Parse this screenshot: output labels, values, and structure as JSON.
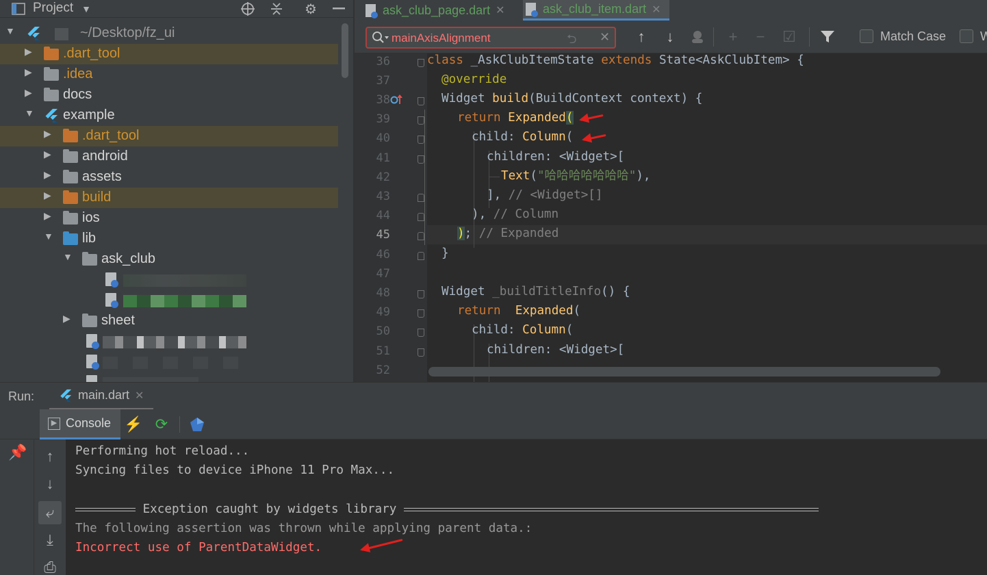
{
  "project_panel": {
    "title": "Project",
    "root_path": "~/Desktop/fz_ui",
    "items": [
      {
        "label": ".dart_tool"
      },
      {
        "label": ".idea"
      },
      {
        "label": "docs"
      },
      {
        "label": "example"
      },
      {
        "label": ".dart_tool"
      },
      {
        "label": "android"
      },
      {
        "label": "assets"
      },
      {
        "label": "build"
      },
      {
        "label": "ios"
      },
      {
        "label": "lib"
      },
      {
        "label": "ask_club"
      },
      {
        "label": "sheet"
      }
    ]
  },
  "editor": {
    "tabs": [
      {
        "label": "ask_club_page.dart",
        "active": false
      },
      {
        "label": "ask_club_item.dart",
        "active": true
      }
    ],
    "search": {
      "value": "mainAxisAlignment",
      "match_case_label": "Match Case",
      "words_label": "W"
    },
    "line_numbers": [
      "36",
      "37",
      "38",
      "39",
      "40",
      "41",
      "42",
      "43",
      "44",
      "45",
      "46",
      "47",
      "48",
      "49",
      "50",
      "51",
      "52"
    ],
    "current_line": "45",
    "code": {
      "l36": {
        "kw": "class",
        "name": " _AskClubItemState ",
        "kw2": "extends",
        "rest": " State<AskClubItem> {"
      },
      "l37": {
        "anno": "@override"
      },
      "l38": {
        "type": "Widget ",
        "fn": "build",
        "rest": "(BuildContext context) {"
      },
      "l39": {
        "kw": "return ",
        "fn": "Expanded",
        "bracket": "("
      },
      "l40": {
        "prop": "child: ",
        "fn": "Column",
        "rest": "("
      },
      "l41": {
        "text": "children: <Widget>["
      },
      "l42": {
        "fn": "Text",
        "open": "(",
        "str": "\"哈哈哈哈哈哈哈\"",
        "close": "),"
      },
      "l43": {
        "text": "], ",
        "comment": "// <Widget>[]"
      },
      "l44": {
        "text": "), ",
        "comment": "// Column"
      },
      "l45": {
        "bracket": ")",
        "text": "; ",
        "comment": "// Expanded"
      },
      "l46": {
        "text": "}"
      },
      "l48": {
        "type": "Widget ",
        "fn": "_buildTitleInfo",
        "rest": "() {"
      },
      "l49": {
        "kw": "return  ",
        "fn": "Expanded",
        "rest": "("
      },
      "l50": {
        "prop": "child: ",
        "fn": "Column",
        "rest": "("
      },
      "l51": {
        "text": "children: <Widget>["
      }
    }
  },
  "run_panel": {
    "label": "Run:",
    "tab_label": "main.dart",
    "console_tab_label": "Console",
    "lines": {
      "l1": "Performing hot reload...",
      "l2": "Syncing files to device iPhone 11 Pro Max...",
      "l4_title": " Exception caught by widgets library ",
      "l5": "The following assertion was thrown while applying parent data.:",
      "l6": "Incorrect use of ParentDataWidget."
    }
  },
  "colors": {
    "keyword": "#cc7832",
    "function": "#ffc66d",
    "string": "#6a8759",
    "comment": "#808080",
    "error": "#ff6b68",
    "annotation_arrow": "#e0201d"
  },
  "icons": [
    "flutter-icon",
    "gear-icon",
    "collapse-icon",
    "locate-icon",
    "search-icon",
    "close-icon",
    "arrow-up-icon",
    "arrow-down-icon",
    "filter-icon",
    "stop-icon",
    "pin-icon",
    "lightning-icon",
    "refresh-icon",
    "dart-devtools-icon",
    "soft-wrap-icon",
    "scroll-to-end-icon",
    "print-icon"
  ]
}
